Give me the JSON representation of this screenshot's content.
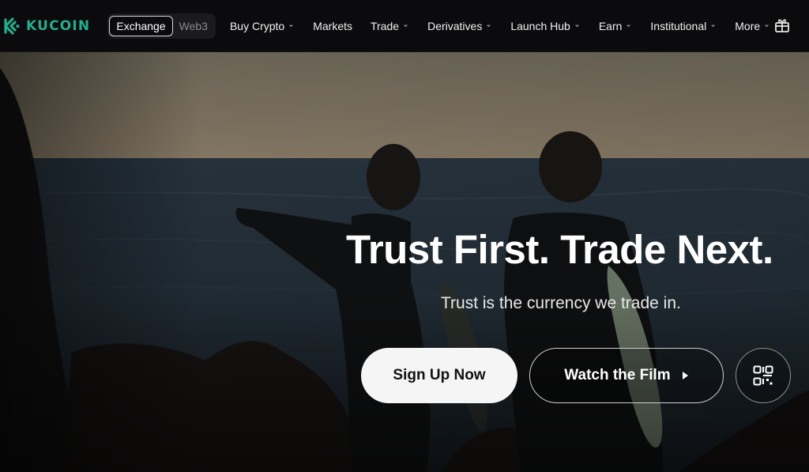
{
  "brand": {
    "name": "KUCOIN",
    "color": "#24ae8f",
    "icon": "kucoin-logo-icon"
  },
  "nav": {
    "switch": {
      "exchange": "Exchange",
      "web3": "Web3"
    },
    "items": [
      {
        "label": "Buy Crypto",
        "dropdown": true
      },
      {
        "label": "Markets",
        "dropdown": false
      },
      {
        "label": "Trade",
        "dropdown": true
      },
      {
        "label": "Derivatives",
        "dropdown": true
      },
      {
        "label": "Launch Hub",
        "dropdown": true
      },
      {
        "label": "Earn",
        "dropdown": true
      },
      {
        "label": "Institutional",
        "dropdown": true
      },
      {
        "label": "More",
        "dropdown": true
      }
    ],
    "right_icon": "gift-box-icon"
  },
  "hero": {
    "headline": "Trust First. Trade Next.",
    "subline": "Trust is the currency we trade in.",
    "primary_button": "Sign Up Now",
    "secondary_button": "Watch the Film",
    "secondary_icon": "play-triangle-icon",
    "qr_icon": "qr-code-icon"
  }
}
